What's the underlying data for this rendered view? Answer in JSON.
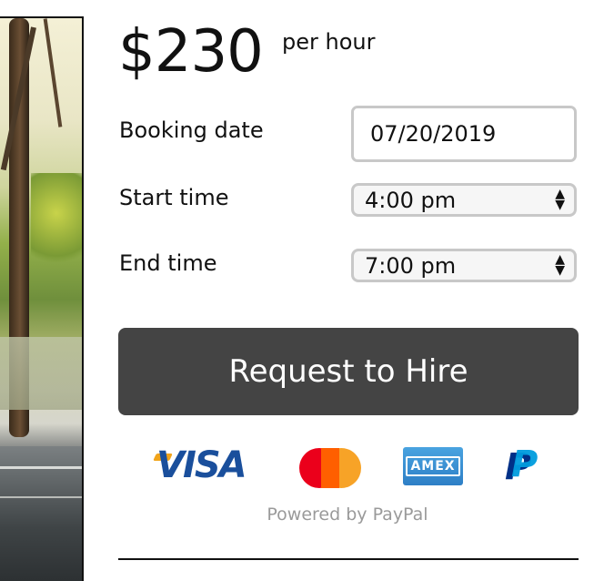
{
  "price": {
    "amount": "$230",
    "unit": "per hour"
  },
  "booking": {
    "date_label": "Booking date",
    "date_value": "07/20/2019",
    "start_label": "Start time",
    "start_value": "4:00 pm",
    "end_label": "End time",
    "end_value": "7:00 pm"
  },
  "cta": {
    "label": "Request to Hire"
  },
  "payment": {
    "visa": "VISA",
    "amex": "AMEX",
    "paypal_logo": "P",
    "powered_by": "Powered by PayPal",
    "icons": [
      "visa-icon",
      "mastercard-icon",
      "amex-icon",
      "paypal-icon"
    ]
  },
  "colors": {
    "cta_bg": "#444444",
    "visa_blue": "#1a4f9c",
    "mc_red": "#eb001b",
    "mc_orange": "#f79e1b",
    "amex_blue": "#2e7fc6",
    "paypal_dark": "#003087",
    "paypal_light": "#009cde"
  }
}
